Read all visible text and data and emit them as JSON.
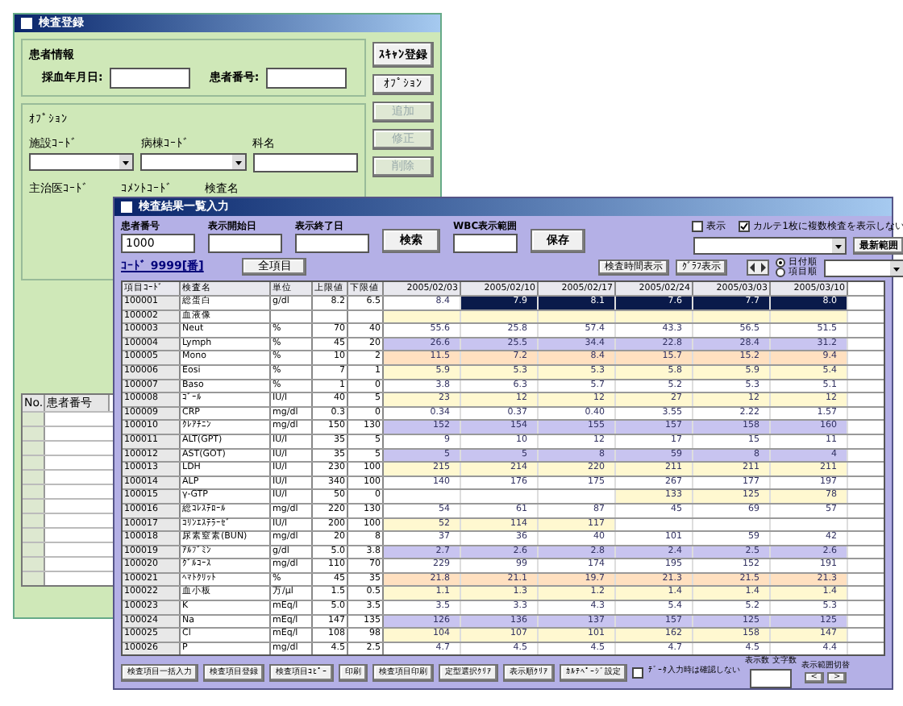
{
  "back_window": {
    "title": "検査登録",
    "patient_group": {
      "title": "患者情報",
      "fields": [
        {
          "label": "採血年月日:"
        },
        {
          "label": "患者番号:"
        }
      ]
    },
    "scan_button": "ｽｷｬﾝ登録",
    "option_group": {
      "title": "ｵﾌﾟｼｮﾝ",
      "selects": [
        {
          "label": "施設ｺｰﾄﾞ",
          "kind": "dropdown"
        },
        {
          "label": "病棟ｺｰﾄﾞ",
          "kind": "dropdown"
        },
        {
          "label": "科名",
          "kind": "text"
        }
      ],
      "lower_labels": [
        "主治医ｺｰﾄﾞ",
        "ｺﾒﾝﾄｺｰﾄﾞ",
        "検査名"
      ]
    },
    "side_buttons": [
      {
        "label": "ｵﾌﾟｼｮﾝ",
        "disabled": false
      },
      {
        "label": "追加",
        "disabled": true
      },
      {
        "label": "修正",
        "disabled": true
      },
      {
        "label": "削除",
        "disabled": true
      }
    ],
    "list_columns": [
      "No.",
      "患者番号"
    ]
  },
  "front_window": {
    "title": "検査結果一覧入力",
    "fields": [
      {
        "label": "患者番号",
        "value": "1000"
      },
      {
        "label": "表示開始日"
      },
      {
        "label": "表示終了日"
      }
    ],
    "search_button": "検索",
    "range_field": {
      "label": "WBC表示範囲"
    },
    "save_button": "保存",
    "checkboxes": [
      {
        "label": "表示",
        "checked": false
      },
      {
        "label": "カルテ1枚に複数検査を表示しない",
        "checked": true
      }
    ],
    "latest_button": "最新範囲",
    "view_buttons": [
      "検査時間表示",
      "ｸﾞﾗﾌ表示"
    ],
    "code_link": "ｺｰﾄﾞ 9999[番]",
    "all_button": "全項目",
    "order_radios": [
      {
        "label": "日付順",
        "selected": true
      },
      {
        "label": "項目順",
        "selected": false
      }
    ],
    "table": {
      "columns": [
        "項目ｺｰﾄﾞ",
        "検査名",
        "単位",
        "上限値",
        "下限値",
        "2005/02/03",
        "2005/02/10",
        "2005/02/17",
        "2005/02/24",
        "2005/03/03",
        "2005/03/10"
      ],
      "rows": [
        {
          "code": "100001",
          "name": "総蛋白",
          "unit": "g/dl",
          "upper": "8.2",
          "lower": "6.5",
          "values": [
            "8.4",
            "7.9",
            "8.1",
            "7.6",
            "7.7",
            "8.0"
          ],
          "color": "#ffffff",
          "selected": true
        },
        {
          "code": "100002",
          "name": "血液像",
          "color": "#fff8d0",
          "selected": false
        },
        {
          "code": "100003",
          "name": "Neut",
          "unit": "%",
          "upper": "70",
          "lower": "40",
          "values": [
            "55.6",
            "25.8",
            "57.4",
            "43.3",
            "56.5",
            "51.5"
          ],
          "color": "#ffffff",
          "selected": false
        },
        {
          "code": "100004",
          "name": "Lymph",
          "unit": "%",
          "upper": "45",
          "lower": "20",
          "values": [
            "26.6",
            "25.5",
            "34.4",
            "22.8",
            "28.4",
            "31.2"
          ],
          "color": "#c8c4f0",
          "selected": false
        },
        {
          "code": "100005",
          "name": "Mono",
          "unit": "%",
          "upper": "10",
          "lower": "2",
          "values": [
            "11.5",
            "7.2",
            "8.4",
            "15.7",
            "15.2",
            "9.4"
          ],
          "color": "#ffe0c0",
          "selected": false
        },
        {
          "code": "100006",
          "name": "Eosi",
          "unit": "%",
          "upper": "7",
          "lower": "1",
          "values": [
            "5.9",
            "5.3",
            "5.3",
            "5.8",
            "5.9",
            "5.4"
          ],
          "color": "#fff8d0",
          "selected": false
        },
        {
          "code": "100007",
          "name": "Baso",
          "unit": "%",
          "upper": "1",
          "lower": "0",
          "values": [
            "3.8",
            "6.3",
            "5.7",
            "5.2",
            "5.3",
            "5.1"
          ],
          "color": "#ffffff",
          "selected": false
        },
        {
          "code": "100008",
          "name": "ｺﾞｰﾙ",
          "unit": "IU/l",
          "upper": "40",
          "lower": "5",
          "values": [
            "23",
            "12",
            "12",
            "27",
            "12",
            "12"
          ],
          "color": "#fff8d0",
          "selected": false
        },
        {
          "code": "100009",
          "name": "CRP",
          "unit": "mg/dl",
          "upper": "0.3",
          "lower": "0",
          "values": [
            "0.34",
            "0.37",
            "0.40",
            "3.55",
            "2.22",
            "1.57"
          ],
          "color": "#ffffff",
          "selected": false
        },
        {
          "code": "100010",
          "name": "ｸﾚｱﾁﾆﾝ",
          "unit": "mg/dl",
          "upper": "150",
          "lower": "130",
          "values": [
            "152",
            "154",
            "155",
            "157",
            "158",
            "160"
          ],
          "color": "#c8c4f0",
          "selected": false
        },
        {
          "code": "100011",
          "name": "ALT(GPT)",
          "unit": "IU/l",
          "upper": "35",
          "lower": "5",
          "values": [
            "9",
            "10",
            "12",
            "17",
            "15",
            "11"
          ],
          "color": "#ffffff",
          "selected": false
        },
        {
          "code": "100012",
          "name": "AST(GOT)",
          "unit": "IU/l",
          "upper": "35",
          "lower": "5",
          "values": [
            "5",
            "5",
            "8",
            "59",
            "8",
            "4"
          ],
          "color": "#c8c4f0",
          "selected": false
        },
        {
          "code": "100013",
          "name": "LDH",
          "unit": "IU/l",
          "upper": "230",
          "lower": "100",
          "values": [
            "215",
            "214",
            "220",
            "211",
            "211",
            "211"
          ],
          "color": "#fff8d0",
          "selected": false
        },
        {
          "code": "100014",
          "name": "ALP",
          "unit": "IU/l",
          "upper": "340",
          "lower": "100",
          "values": [
            "140",
            "176",
            "175",
            "267",
            "177",
            "197"
          ],
          "color": "#ffffff",
          "selected": false
        },
        {
          "code": "100015",
          "name": "γ-GTP",
          "unit": "IU/l",
          "upper": "50",
          "lower": "0",
          "values": [
            {
              "blank": true
            },
            {
              "blank": true
            },
            {
              "blank": true
            },
            "133",
            "125",
            "78"
          ],
          "color": "#fff8d0",
          "selected": false
        },
        {
          "code": "100016",
          "name": "総ｺﾚｽﾃﾛｰﾙ",
          "unit": "mg/dl",
          "upper": "220",
          "lower": "130",
          "values": [
            "54",
            "61",
            "87",
            "45",
            "69",
            "57"
          ],
          "color": "#ffffff",
          "selected": false
        },
        {
          "code": "100017",
          "name": "ｺﾘﾝｴｽﾃﾗｰｾﾞ",
          "unit": "IU/l",
          "upper": "200",
          "lower": "100",
          "values": [
            "52",
            "114",
            "117",
            {
              "blank": true
            },
            {
              "blank": true
            },
            {
              "blank": true
            }
          ],
          "color": "#fff8d0",
          "selected": false
        },
        {
          "code": "100018",
          "name": "尿素窒素(BUN)",
          "unit": "mg/dl",
          "upper": "20",
          "lower": "8",
          "values": [
            "37",
            "36",
            "40",
            "101",
            "59",
            "42"
          ],
          "color": "#ffffff",
          "selected": false
        },
        {
          "code": "100019",
          "name": "ｱﾙﾌﾞﾐﾝ",
          "unit": "g/dl",
          "upper": "5.0",
          "lower": "3.8",
          "values": [
            "2.7",
            "2.6",
            "2.8",
            "2.4",
            "2.5",
            "2.6"
          ],
          "color": "#c8c4f0",
          "selected": false
        },
        {
          "code": "100020",
          "name": "ｸﾞﾙｺｰｽ",
          "unit": "mg/dl",
          "upper": "110",
          "lower": "70",
          "values": [
            "229",
            "99",
            "174",
            "195",
            "152",
            "191"
          ],
          "color": "#ffffff",
          "selected": false
        },
        {
          "code": "100021",
          "name": "ﾍﾏﾄｸﾘｯﾄ",
          "unit": "%",
          "upper": "45",
          "lower": "35",
          "values": [
            "21.8",
            "21.1",
            "19.7",
            "21.3",
            "21.5",
            "21.3"
          ],
          "color": "#ffe0c0",
          "selected": false
        },
        {
          "code": "100022",
          "name": "血小板",
          "unit": "万/μl",
          "upper": "1.5",
          "lower": "0.5",
          "values": [
            "1.1",
            "1.3",
            "1.2",
            "1.4",
            "1.4",
            "1.4"
          ],
          "color": "#fff8d0",
          "selected": false
        },
        {
          "code": "100023",
          "name": "K",
          "unit": "mEq/l",
          "upper": "5.0",
          "lower": "3.5",
          "values": [
            "3.5",
            "3.3",
            "4.3",
            "5.4",
            "5.2",
            "5.3"
          ],
          "color": "#ffffff",
          "selected": false
        },
        {
          "code": "100024",
          "name": "Na",
          "unit": "mEq/l",
          "upper": "147",
          "lower": "135",
          "values": [
            "126",
            "136",
            "137",
            "157",
            "125",
            "125"
          ],
          "color": "#c8c4f0",
          "selected": false
        },
        {
          "code": "100025",
          "name": "Cl",
          "unit": "mEq/l",
          "upper": "108",
          "lower": "98",
          "values": [
            "104",
            "107",
            "101",
            "162",
            "158",
            "147"
          ],
          "color": "#fff8d0",
          "selected": false
        },
        {
          "code": "100026",
          "name": "P",
          "unit": "mg/dl",
          "upper": "4.5",
          "lower": "2.5",
          "values": [
            "4.7",
            "4.5",
            "4.5",
            "4.7",
            "4.5",
            "4.4"
          ],
          "color": "#ffffff",
          "selected": false
        }
      ]
    },
    "bottom_buttons": [
      "検査項目一括入力",
      "検査項目登録",
      "検査項目ｺﾋﾟｰ",
      "印刷",
      "検査項目印刷",
      "定型選択ｸﾘｱ",
      "表示順ｸﾘｱ",
      "ｶﾙﾃﾍﾟｰｼﾞ設定"
    ],
    "confirm_checkbox": {
      "label": "ﾃﾞｰﾀ入力時は確認しない",
      "checked": false
    },
    "count_labels": [
      "表示数",
      "文字数"
    ],
    "range_label": "表示範囲切替",
    "nav_buttons": [
      "<",
      ">"
    ]
  }
}
